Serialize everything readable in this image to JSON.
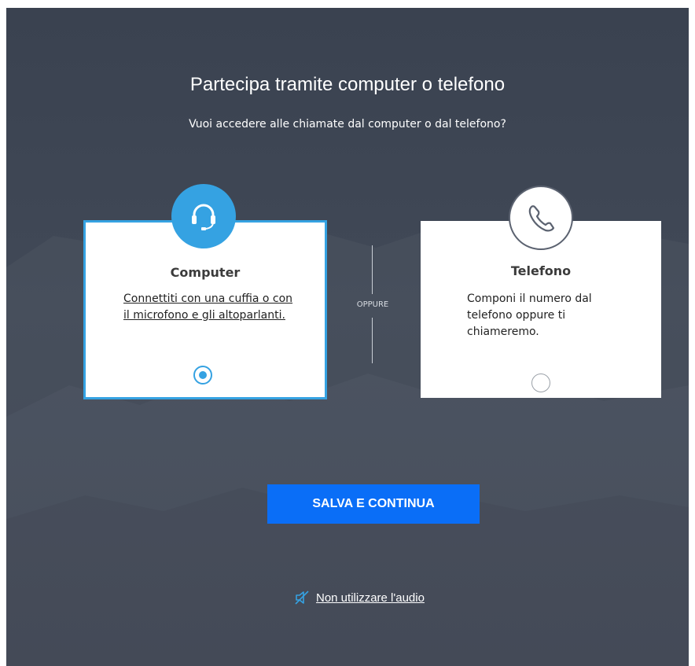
{
  "dialog": {
    "title": "Partecipa tramite computer o telefono",
    "subtitle": "Vuoi accedere alle chiamate dal computer o dal telefono?"
  },
  "options": {
    "computer": {
      "title": "Computer",
      "description": "Connettiti con una cuffia o con il microfono e gli altoparlanti.",
      "icon": "headset-icon",
      "selected": true
    },
    "phone": {
      "title": "Telefono",
      "description": "Componi il numero dal telefono oppure ti chiameremo.",
      "icon": "phone-icon",
      "selected": false
    },
    "divider_label": "OPPURE"
  },
  "actions": {
    "save_label": "SALVA E CONTINUA",
    "no_audio_label": "Non utilizzare l'audio",
    "no_audio_icon": "speaker-off-icon"
  },
  "colors": {
    "accent": "#35a2e2",
    "button": "#0a6ef7",
    "background": "#3d4451"
  }
}
